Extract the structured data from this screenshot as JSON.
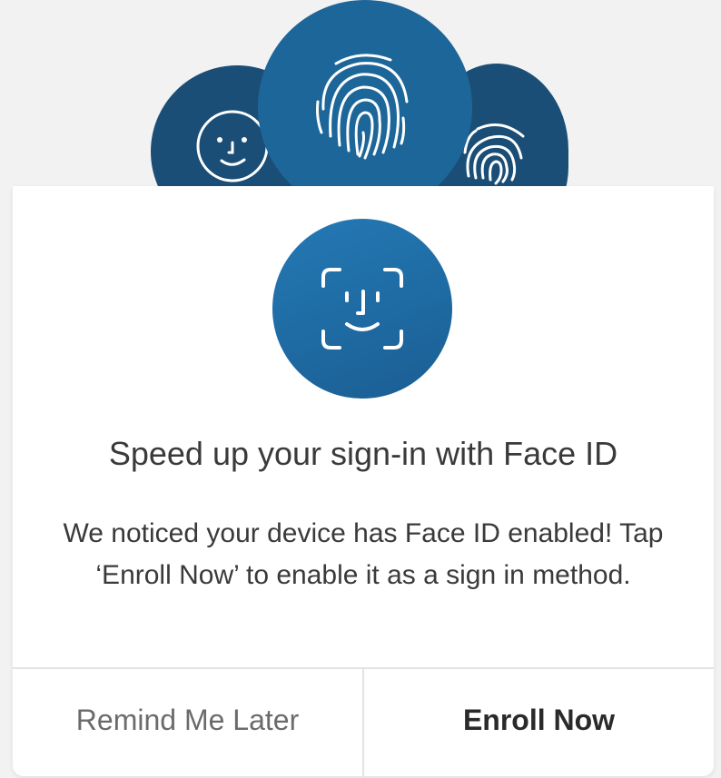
{
  "dialog": {
    "title": "Speed up your sign-in with Face ID",
    "description": "We noticed your device has Face ID enabled! Tap ‘Enroll Now’ to enable it as a sign in method.",
    "remind_label": "Remind Me Later",
    "enroll_label": "Enroll Now"
  },
  "icons": {
    "hero_left": "smiley-face-icon",
    "hero_center": "fingerprint-icon",
    "hero_right": "fingerprint-icon",
    "badge": "face-id-icon"
  },
  "colors": {
    "hero_dark": "#1b4e76",
    "hero_center": "#1d6699",
    "badge": "#1f6ca5",
    "text": "#3a3a3a",
    "secondary_text": "#6b6b6b"
  }
}
